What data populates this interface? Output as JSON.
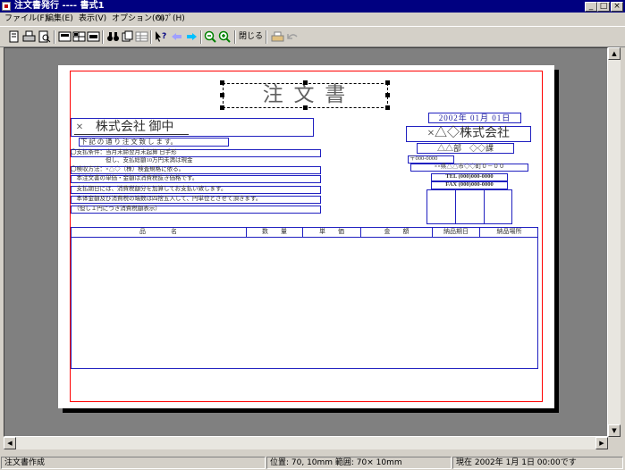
{
  "window": {
    "title": "注文書発行 ---- 書式1",
    "minimize": "_",
    "maximize": "□",
    "close": "×"
  },
  "menu": [
    {
      "label": "ファイル(F)"
    },
    {
      "label": "編集(E)"
    },
    {
      "label": "表示(V)"
    },
    {
      "label": "オプション(O)"
    },
    {
      "label": "ﾍﾙﾌﾟ(H)"
    }
  ],
  "toolbar": {
    "close_label": "閉じる",
    "icons": [
      "new-icon",
      "print-icon",
      "print-preview-icon",
      "form-icon",
      "grid-icon",
      "list-icon",
      "binoculars-icon",
      "copy-icon",
      "table-icon",
      "help-cursor-icon",
      "back-arrow-icon",
      "forward-arrow-icon",
      "zoom-out-icon",
      "zoom-in-icon",
      "print-icon-2",
      "undo-icon"
    ]
  },
  "form": {
    "title": "注 文 書",
    "date": "2002年 01月 01日",
    "recipient": "×　株式会社 御中",
    "intro": "下 記 の 通 り 注 文 致 し ま す。",
    "terms": [
      "〇支払条件：当月末締翌月末起算 日手形",
      "　　　　　　但し、支払総額10万円未満は現金",
      "〇検収方法：×△◇（株）検査規格に依る。",
      "　本注文書の単価・金額は消費税抜き価格です。",
      "　支払期日には、消費税額分を加算してお支払い致します。",
      "　本体金額及び消費税の端数は四捨五入して、円単位とさせて頂きます。",
      "　（但し１円につき消費税額表示）"
    ],
    "company": "×△◇株式会社",
    "department": "△△部　◇◇課",
    "postal": "〒000-0000",
    "address": "××県△△市◇◇町０－００",
    "tel": "TEL (000)000-0000",
    "fax": "FAX (000)000-0000",
    "columns": [
      "品　　　　名",
      "数　　量",
      "単　　価",
      "金　　額",
      "納品期日",
      "納品場所"
    ]
  },
  "status": {
    "mode": "注文書作成",
    "position": "位置:  70,  10mm  範囲:  70× 10mm",
    "current": "現在 2002年  1月  1日 00:00です"
  }
}
